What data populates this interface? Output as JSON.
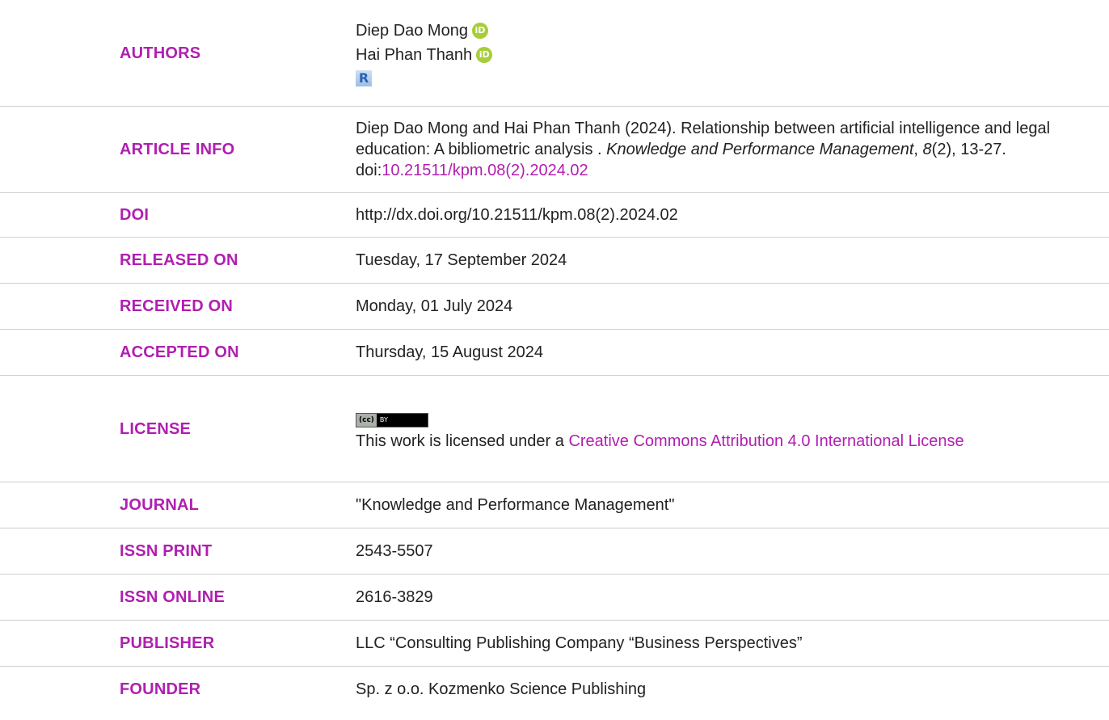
{
  "rows": {
    "authors": {
      "label": "AUTHORS",
      "names": [
        "Diep Dao Mong",
        "Hai Phan Thanh"
      ]
    },
    "article_info": {
      "label": "ARTICLE INFO",
      "citation_prefix": "Diep Dao Mong and Hai Phan Thanh (2024). Relationship between artificial intelligence and legal education: A bibliometric analysis . ",
      "journal_name": "Knowledge and Performance Management",
      "comma": ", ",
      "volume": "8",
      "issue_pages": "(2), 13-27. doi:",
      "doi_link": "10.21511/kpm.08(2).2024.02"
    },
    "doi": {
      "label": "DOI",
      "value": "http://dx.doi.org/10.21511/kpm.08(2).2024.02"
    },
    "released": {
      "label": "RELEASED ON",
      "value": "Tuesday, 17 September 2024"
    },
    "received": {
      "label": "RECEIVED ON",
      "value": "Monday, 01 July 2024"
    },
    "accepted": {
      "label": "ACCEPTED ON",
      "value": "Thursday, 15 August 2024"
    },
    "license": {
      "label": "LICENSE",
      "badge_cc": "(cc)",
      "badge_by": "BY",
      "text_prefix": "This work is licensed under a ",
      "link_text": "Creative Commons Attribution 4.0 International License"
    },
    "journal": {
      "label": "JOURNAL",
      "value": "\"Knowledge and Performance Management\""
    },
    "issn_print": {
      "label": "ISSN PRINT",
      "value": "2543-5507"
    },
    "issn_online": {
      "label": "ISSN ONLINE",
      "value": "2616-3829"
    },
    "publisher": {
      "label": "PUBLISHER",
      "value": "LLC “Consulting Publishing Company “Business Perspectives”"
    },
    "founder": {
      "label": "FOUNDER",
      "value": "Sp. z o.o. Kozmenko Science Publishing"
    }
  },
  "icons": {
    "orcid_glyph": "iD",
    "researcher_glyph": "R"
  },
  "colors": {
    "label": "#b01fb0",
    "link": "#b01fb0",
    "orcid": "#a6ce39"
  }
}
